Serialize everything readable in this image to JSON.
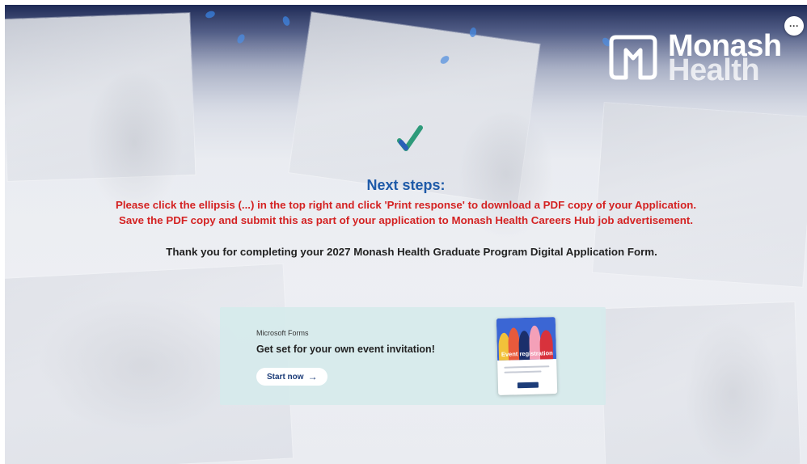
{
  "brand": {
    "logo_line1": "Monash",
    "logo_line2": "Health"
  },
  "toolbar": {
    "more_label": "···"
  },
  "completion": {
    "title": "Next steps:",
    "instruction_line1": "Please click the ellipsis (...) in the top right and click 'Print response' to download a PDF copy of your Application.",
    "instruction_line2": "Save the PDF copy and submit this as part of your application to Monash Health Careers Hub job advertisement.",
    "thanks": "Thank you for completing your 2027 Monash Health Graduate Program Digital Application Form."
  },
  "promo": {
    "brand": "Microsoft Forms",
    "headline": "Get set for your own event invitation!",
    "button_label": "Start now",
    "button_icon": "arrow-right-icon",
    "card_title": "Event registration"
  },
  "colors": {
    "title_blue": "#1e5aa8",
    "instruction_red": "#d42222",
    "promo_bg": "#d6eaec",
    "button_text": "#1c3c78"
  }
}
